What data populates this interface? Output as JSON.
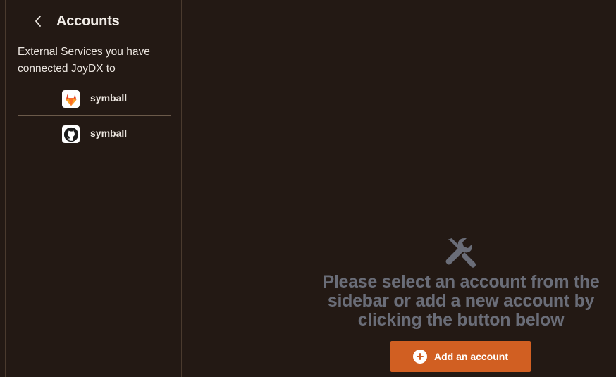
{
  "sidebar": {
    "title": "Accounts",
    "description": "External Services you have connected JoyDX to",
    "accounts": [
      {
        "label": "symball",
        "service_icon": "gitlab-icon"
      },
      {
        "label": "symball",
        "service_icon": "github-icon"
      }
    ]
  },
  "main": {
    "empty_message": "Please select an account from the sidebar or add a new account by clicking the button below",
    "add_button_label": "Add an account",
    "accent_color": "#d15f22"
  }
}
